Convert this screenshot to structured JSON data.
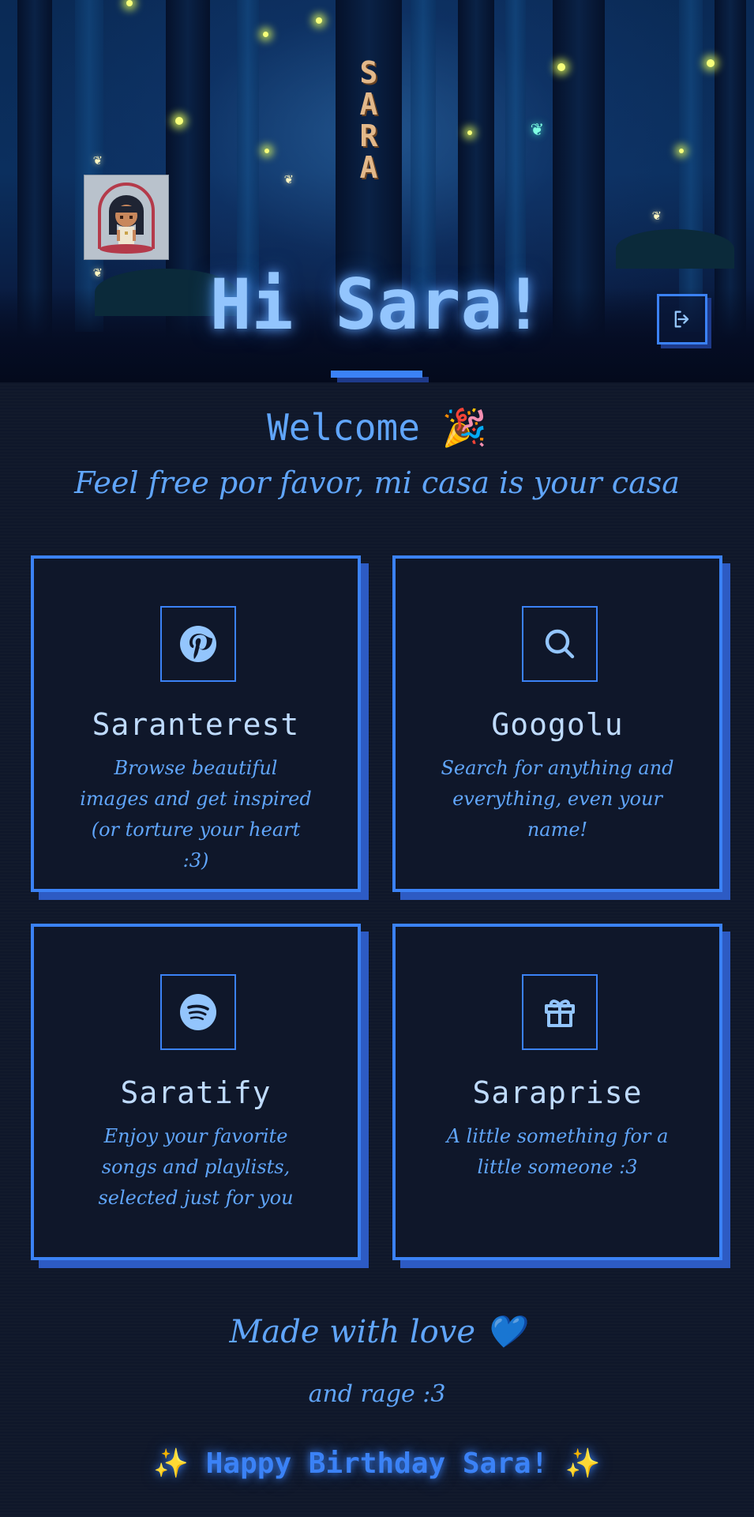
{
  "hero": {
    "vertical_name": [
      "S",
      "A",
      "R",
      "A"
    ],
    "title": "Hi Sara!",
    "logout_icon": "logout-icon"
  },
  "welcome": {
    "heading": "Welcome 🎉",
    "subtitle": "Feel free por favor, mi casa is your casa"
  },
  "cards": [
    {
      "icon": "pinterest-icon",
      "title": "Saranterest",
      "description": "Browse beautiful images and get inspired (or torture your heart :3)"
    },
    {
      "icon": "search-icon",
      "title": "Googolu",
      "description": "Search for anything and everything, even your name!"
    },
    {
      "icon": "spotify-icon",
      "title": "Saratify",
      "description": "Enjoy your favorite songs and playlists, selected just for you"
    },
    {
      "icon": "gift-icon",
      "title": "Saraprise",
      "description": "A little something for a little someone :3"
    }
  ],
  "footer": {
    "made_with": "Made with love 💙",
    "and_rage": "and rage :3",
    "birthday": "✨ Happy Birthday Sara! ✨"
  },
  "colors": {
    "background": "#0f172a",
    "accent": "#3b82f6",
    "accent_shadow": "#2d5bc4",
    "text": "#60a5fa",
    "title_text": "#bfdbfe"
  }
}
